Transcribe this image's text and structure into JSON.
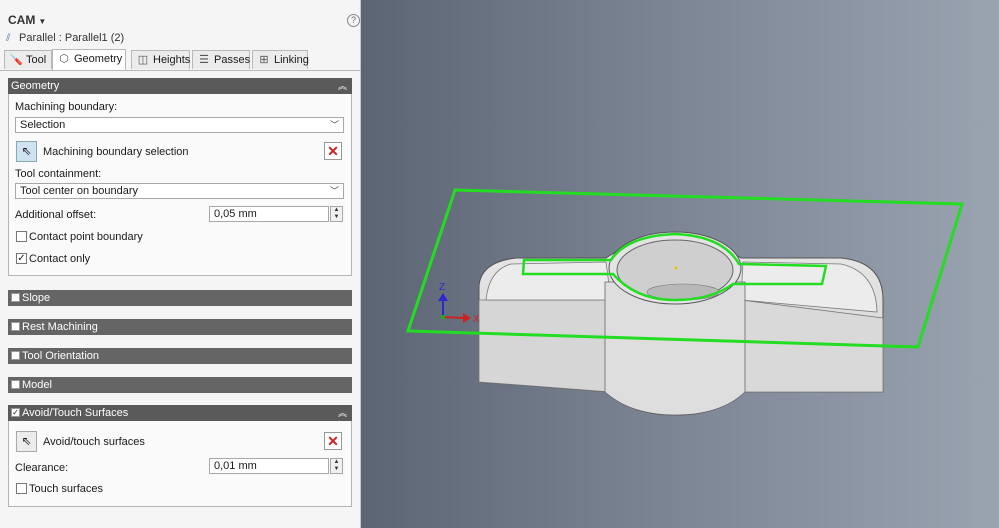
{
  "panel": {
    "title": "CAM",
    "help": "?",
    "operation": "Parallel : Parallel1 (2)",
    "tabs": [
      {
        "label": "Tool",
        "icon": "tool-icon"
      },
      {
        "label": "Geometry",
        "icon": "geometry-icon",
        "active": true
      },
      {
        "label": "Heights",
        "icon": "heights-icon"
      },
      {
        "label": "Passes",
        "icon": "passes-icon"
      },
      {
        "label": "Linking",
        "icon": "linking-icon"
      }
    ]
  },
  "geometry": {
    "header": "Geometry",
    "machining_boundary_label": "Machining boundary:",
    "machining_boundary_value": "Selection",
    "boundary_selection_label": "Machining boundary selection",
    "tool_containment_label": "Tool containment:",
    "tool_containment_value": "Tool center on boundary",
    "additional_offset_label": "Additional offset:",
    "additional_offset_value": "0,05 mm",
    "contact_point_boundary_label": "Contact point boundary",
    "contact_point_boundary_checked": false,
    "contact_only_label": "Contact only",
    "contact_only_checked": true
  },
  "sections": {
    "slope": "Slope",
    "rest_machining": "Rest Machining",
    "tool_orientation": "Tool Orientation",
    "model": "Model",
    "avoid_touch": "Avoid/Touch Surfaces"
  },
  "avoid": {
    "checked": true,
    "surfaces_label": "Avoid/touch surfaces",
    "clearance_label": "Clearance:",
    "clearance_value": "0,01 mm",
    "touch_surfaces_label": "Touch surfaces",
    "touch_surfaces_checked": false
  },
  "viewport": {
    "axis_x": "X",
    "axis_z": "Z",
    "boundary_color": "#22dd22",
    "background_color": "#7a8392"
  }
}
